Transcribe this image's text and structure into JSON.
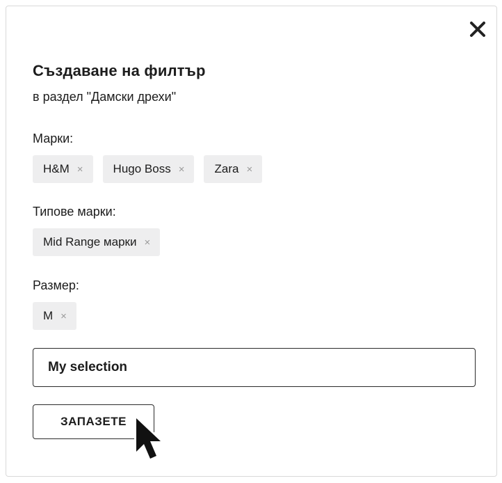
{
  "dialog": {
    "title": "Създаване на филтър",
    "subtitle": "в раздел \"Дамски дрехи\"",
    "close_icon": "close-icon"
  },
  "sections": [
    {
      "label": "Марки:",
      "chips": [
        {
          "label": "H&M",
          "remove": "×"
        },
        {
          "label": "Hugo Boss",
          "remove": "×"
        },
        {
          "label": "Zara",
          "remove": "×"
        }
      ]
    },
    {
      "label": "Типове марки:",
      "chips": [
        {
          "label": "Mid Range марки",
          "remove": "×"
        }
      ]
    },
    {
      "label": "Размер:",
      "chips": [
        {
          "label": "M",
          "remove": "×"
        }
      ]
    }
  ],
  "name_field": {
    "value": "My selection"
  },
  "save_button": {
    "label": "ЗАПАЗЕТЕ"
  },
  "pointer": {
    "icon": "mouse-pointer-icon"
  },
  "colors": {
    "chip_background": "#eeeeef",
    "chip_remove": "#9a9a9a",
    "text": "#1c1c1c",
    "border": "#2a2a2a"
  }
}
